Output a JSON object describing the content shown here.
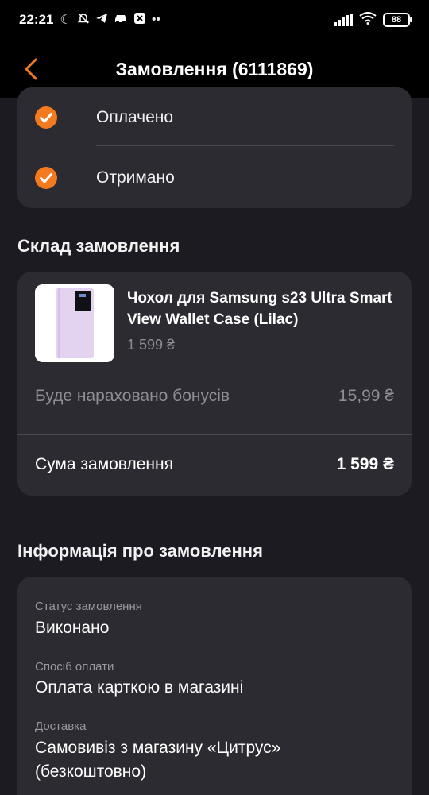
{
  "status_bar": {
    "time": "22:21",
    "left_icons": [
      "moon-icon",
      "bell-off-icon",
      "telegram-icon",
      "car-icon",
      "notification-icon",
      "more-dots-icon"
    ],
    "battery": "88"
  },
  "header": {
    "title": "Замовлення (6111869)",
    "back_icon": "chevron-left-icon"
  },
  "status_steps": [
    {
      "label": "Оплачено",
      "icon": "check-circle-icon"
    },
    {
      "label": "Отримано",
      "icon": "check-circle-icon"
    }
  ],
  "order_contents": {
    "title": "Склад замовлення",
    "product": {
      "name": "Чохол для Samsung s23 Ultra Smart View Wallet Case (Lilac)",
      "price": "1 599 ₴"
    },
    "bonus_label": "Буде нараховано бонусів",
    "bonus_value": "15,99 ₴",
    "total_label": "Сума замовлення",
    "total_value": "1 599 ₴"
  },
  "order_info": {
    "title": "Інформація про замовлення",
    "fields": [
      {
        "label": "Статус замовлення",
        "value": "Виконано"
      },
      {
        "label": "Спосіб оплати",
        "value": "Оплата карткою в магазині"
      },
      {
        "label": "Доставка",
        "value": "Самовивіз з магазину «Цитрус» (безкоштовно)"
      }
    ]
  },
  "colors": {
    "accent": "#f47a20",
    "background": "#1c1b21",
    "card": "#2c2b31",
    "muted_text": "#8e8d94",
    "product_case": "#e3d3f0"
  }
}
